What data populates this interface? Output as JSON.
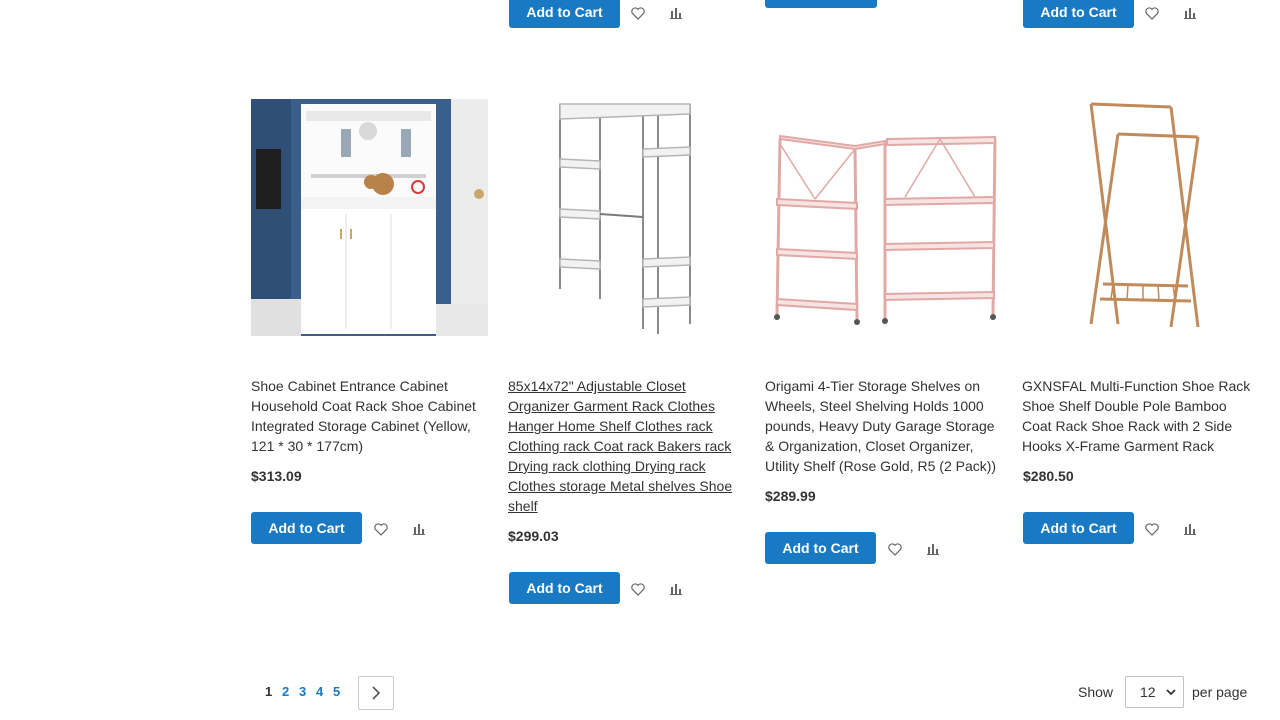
{
  "top_row": {
    "items": [
      {
        "add_to_cart": "Add to Cart"
      },
      {
        "add_to_cart": "Add to Cart"
      }
    ]
  },
  "products": [
    {
      "name": "Shoe Cabinet Entrance Cabinet Household Coat Rack Shoe Cabinet Integrated Storage Cabinet (Yellow, 121 * 30 * 177cm)",
      "price": "$313.09",
      "add_to_cart": "Add to Cart",
      "image": "white-shoe-cabinet"
    },
    {
      "name": "85x14x72\" Adjustable Closet Organizer Garment Rack Clothes Hanger Home Shelf Clothes rack Clothing rack Coat rack Bakers rack Drying rack clothing Drying rack Clothes storage Metal shelves Shoe shelf",
      "price": "$299.03",
      "add_to_cart": "Add to Cart",
      "image": "chrome-wire-garment-rack"
    },
    {
      "name": "Origami 4-Tier Storage Shelves on Wheels, Steel Shelving Holds 1000 pounds, Heavy Duty Garage Storage & Organization, Closet Organizer, Utility Shelf (Rose Gold, R5 (2 Pack))",
      "price": "$289.99",
      "add_to_cart": "Add to Cart",
      "image": "rose-gold-shelves"
    },
    {
      "name": "GXNSFAL Multi-Function Shoe Rack Shoe Shelf Double Pole Bamboo Coat Rack Shoe Rack with 2 Side Hooks X-Frame Garment Rack",
      "price": "$280.50",
      "add_to_cart": "Add to Cart",
      "image": "bamboo-x-frame-rack"
    }
  ],
  "icons": {
    "wishlist": "heart-icon",
    "compare": "bar-chart-icon",
    "next": "chevron-right-icon",
    "select": "chevron-down-icon"
  },
  "pager": {
    "current": "1",
    "pages": [
      "2",
      "3",
      "4",
      "5"
    ]
  },
  "limiter": {
    "show_label": "Show",
    "value": "12",
    "per_page_label": "per page"
  },
  "colors": {
    "accent": "#1979c3",
    "text": "#333333"
  }
}
